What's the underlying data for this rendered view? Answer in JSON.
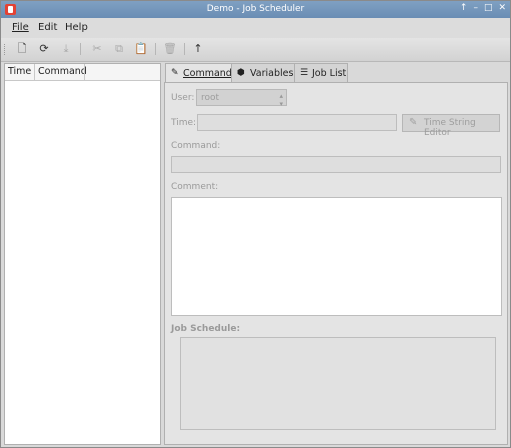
{
  "window": {
    "title": "Demo - Job Scheduler",
    "controls": [
      "↑",
      "–",
      "□",
      "✕"
    ]
  },
  "menu": [
    {
      "label": "File",
      "mnemonic": "F"
    },
    {
      "label": "Edit",
      "mnemonic": "E"
    },
    {
      "label": "Help",
      "mnemonic": "H"
    }
  ],
  "toolbar": [
    {
      "name": "new-icon",
      "glyph": "🗋",
      "enabled": true
    },
    {
      "name": "reload-icon",
      "glyph": "⟳",
      "enabled": true
    },
    {
      "name": "download-icon",
      "glyph": "⤓",
      "enabled": false
    },
    {
      "name": "cut-icon",
      "glyph": "✂",
      "enabled": false
    },
    {
      "name": "copy-icon",
      "glyph": "⧉",
      "enabled": false
    },
    {
      "name": "paste-icon",
      "glyph": "📋",
      "enabled": false
    },
    {
      "name": "delete-icon",
      "glyph": "🗑",
      "enabled": false
    },
    {
      "name": "up-arrow-icon",
      "glyph": "↑",
      "enabled": true
    }
  ],
  "list": {
    "columns": [
      "Time",
      "Command"
    ]
  },
  "tabs": [
    {
      "label": "Command",
      "icon": "pencil-icon",
      "glyph": "✎",
      "active": true
    },
    {
      "label": "Variables",
      "icon": "tag-icon",
      "glyph": "⬢",
      "active": false
    },
    {
      "label": "Job List",
      "icon": "list-icon",
      "glyph": "☰",
      "active": false
    }
  ],
  "form": {
    "user_label": "User:",
    "user_value": "root",
    "time_label": "Time:",
    "time_value": "",
    "time_editor_button": "Time String Editor",
    "command_label": "Command:",
    "command_value": "",
    "comment_label": "Comment:",
    "comment_value": "",
    "schedule_label": "Job Schedule:"
  }
}
